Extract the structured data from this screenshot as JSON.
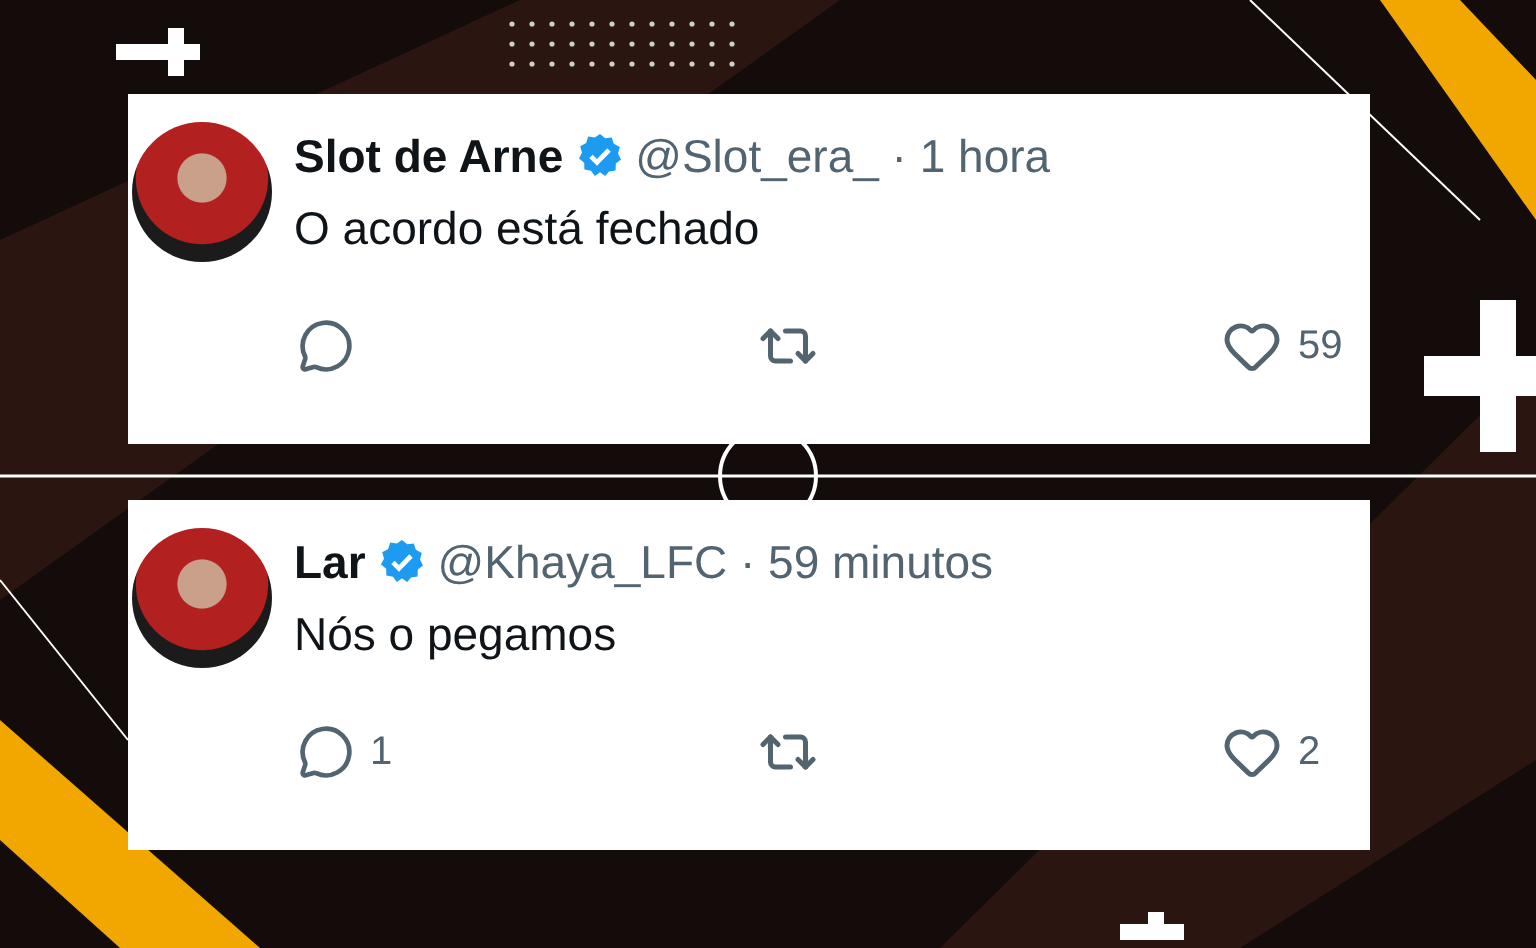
{
  "tweets": [
    {
      "name": "Slot de Arne",
      "verified": true,
      "meta": "@Slot_era_ · 1 hora",
      "text": "O acordo está fechado",
      "actions": [
        {
          "kind": "reply"
        },
        {
          "kind": "retweet"
        },
        {
          "kind": "like",
          "count": "59"
        }
      ]
    },
    {
      "name": "Lar",
      "verified": true,
      "meta": "@Khaya_LFC · 59 minutos",
      "text": "Nós o pegamos",
      "actions": [
        {
          "kind": "reply",
          "count": "1"
        },
        {
          "kind": "retweet"
        },
        {
          "kind": "like",
          "count": "2"
        }
      ]
    }
  ]
}
